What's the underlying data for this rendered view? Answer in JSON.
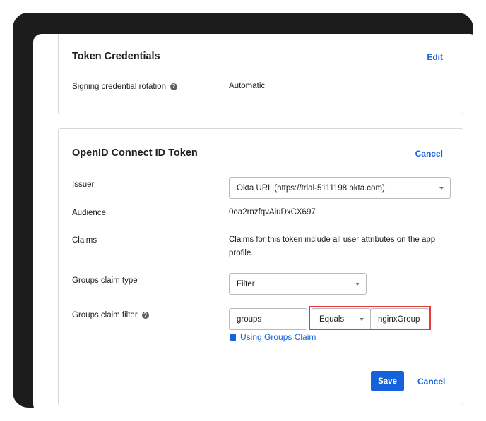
{
  "token_credentials": {
    "title": "Token Credentials",
    "edit_label": "Edit",
    "signing_rotation_label": "Signing credential rotation",
    "signing_rotation_value": "Automatic"
  },
  "oidc": {
    "title": "OpenID Connect ID Token",
    "cancel_label": "Cancel",
    "issuer_label": "Issuer",
    "issuer_value": "Okta URL (https://trial-5111198.okta.com)",
    "audience_label": "Audience",
    "audience_value": "0oa2rnzfqvAiuDxCX697",
    "claims_label": "Claims",
    "claims_value": "Claims for this token include all user attributes on the app profile.",
    "groups_claim_type_label": "Groups claim type",
    "groups_claim_type_value": "Filter",
    "groups_claim_filter_label": "Groups claim filter",
    "filter_name_value": "groups",
    "filter_operator_value": "Equals",
    "filter_match_value": "nginxGroup",
    "using_groups_claim_link": "Using Groups Claim",
    "save_label": "Save",
    "footer_cancel_label": "Cancel"
  },
  "colors": {
    "accent": "#1662dd",
    "highlight": "#e03a3a"
  }
}
